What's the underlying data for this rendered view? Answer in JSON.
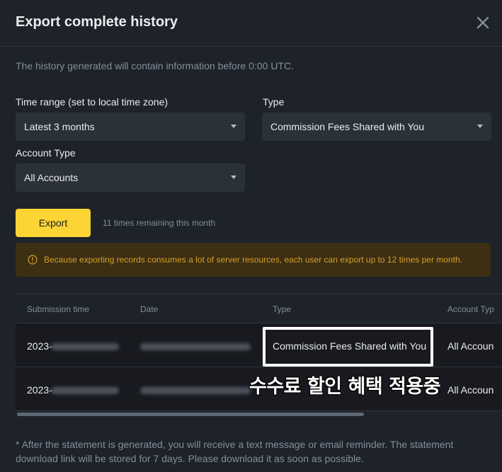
{
  "header": {
    "title": "Export complete history",
    "close_icon": "close-icon"
  },
  "info_text": "The history generated will contain information before 0:00 UTC.",
  "form": {
    "time_range": {
      "label": "Time range (set to local time zone)",
      "value": "Latest 3 months"
    },
    "type": {
      "label": "Type",
      "value": "Commission Fees Shared with You"
    },
    "account_type": {
      "label": "Account Type",
      "value": "All Accounts"
    }
  },
  "export": {
    "label": "Export",
    "remaining": "11 times remaining this month"
  },
  "warning": {
    "icon": "info-circle-icon",
    "text": "Because exporting records consumes a lot of server resources, each user can export up to 12 times per month.",
    "color": "#d89f26"
  },
  "table": {
    "columns": [
      "Submission time",
      "Date",
      "Type",
      "Account Typ"
    ],
    "rows": [
      {
        "submission_prefix": "2023-",
        "type": "Commission Fees Shared with You",
        "account": "All Accoun"
      },
      {
        "submission_prefix": "2023-",
        "type": "",
        "account": "All Accoun"
      }
    ]
  },
  "overlay_text": "수수료 할인 혜택 적용중",
  "footnote": "* After the statement is generated, you will receive a text message or email reminder. The statement download link will be stored for 7 days. Please download it as soon as possible.",
  "colors": {
    "accent": "#fcd535",
    "background": "#1e2329",
    "field": "#2b3139"
  }
}
